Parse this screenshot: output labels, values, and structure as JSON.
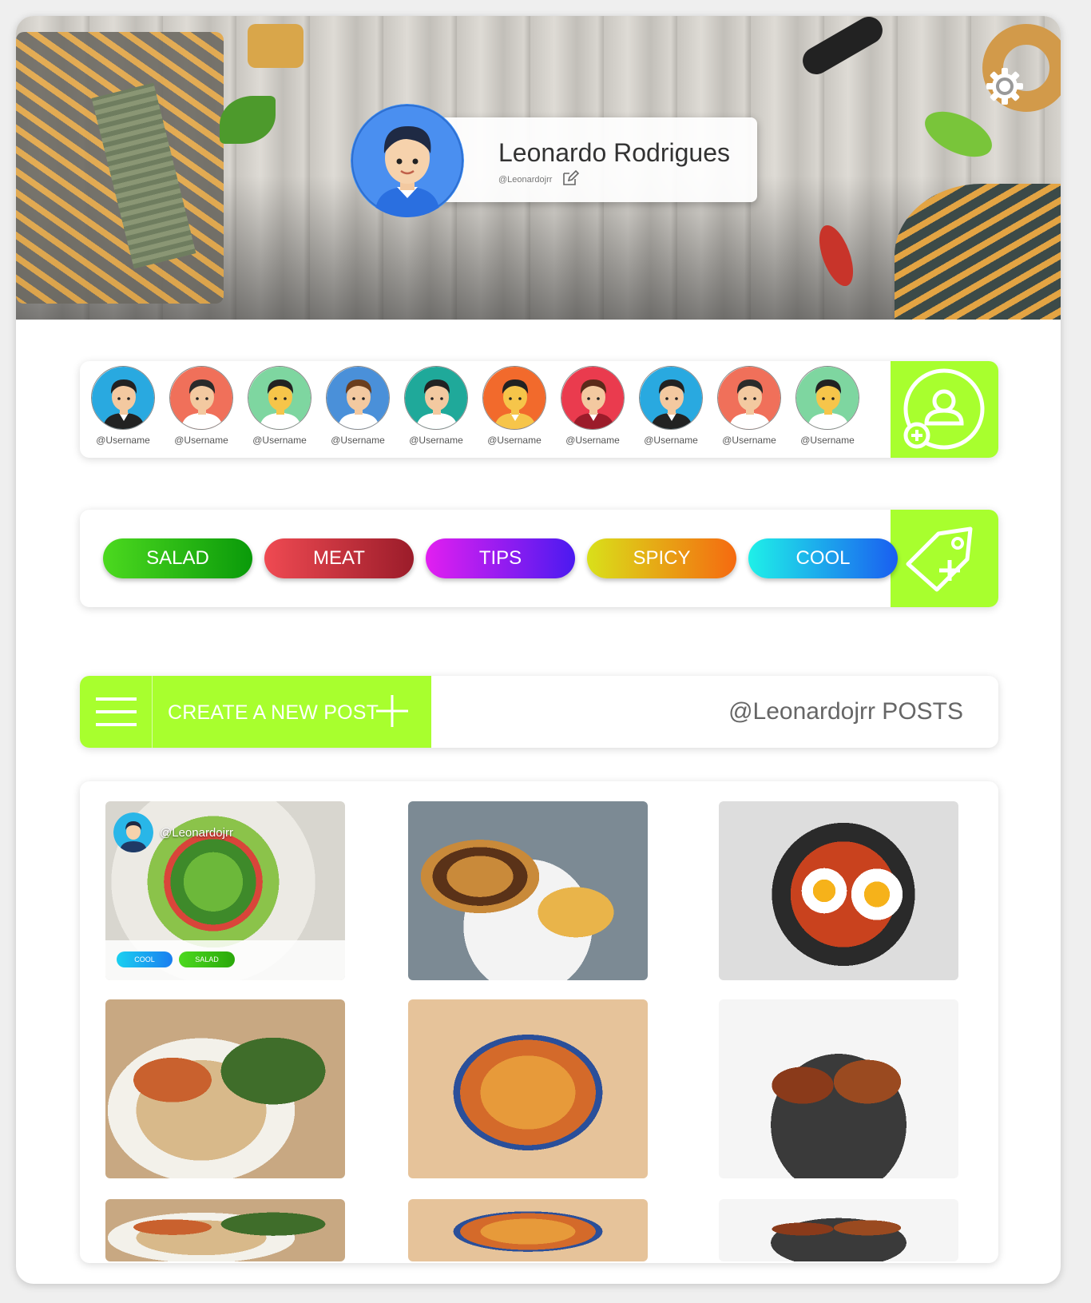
{
  "profile": {
    "name": "Leonardo Rodrigues",
    "handle": "@Leonardojrr"
  },
  "icons": {
    "settings": "gear-icon",
    "edit": "edit-icon",
    "add_friend": "add-user-icon",
    "add_tag": "add-tag-icon",
    "menu": "hamburger-menu-icon",
    "create": "plus-icon"
  },
  "friends": [
    {
      "username": "@Username",
      "bg": "#29a9e0",
      "face": "#f3c9a0",
      "hair": "#222",
      "shirt": "#222"
    },
    {
      "username": "@Username",
      "bg": "#f0705a",
      "face": "#f3c9a0",
      "hair": "#2b2b2b",
      "shirt": "#fff"
    },
    {
      "username": "@Username",
      "bg": "#7ed6a0",
      "face": "#f6c54a",
      "hair": "#222",
      "shirt": "#fff"
    },
    {
      "username": "@Username",
      "bg": "#4a90d9",
      "face": "#f3c9a0",
      "hair": "#6b3e1e",
      "shirt": "#fff"
    },
    {
      "username": "@Username",
      "bg": "#1fa99a",
      "face": "#f3c9a0",
      "hair": "#222",
      "shirt": "#fff"
    },
    {
      "username": "@Username",
      "bg": "#f26a2c",
      "face": "#f6c54a",
      "hair": "#222",
      "shirt": "#f6c54a"
    },
    {
      "username": "@Username",
      "bg": "#ea3b4e",
      "face": "#f3c9a0",
      "hair": "#5a2a1a",
      "shirt": "#9b1c2a"
    },
    {
      "username": "@Username",
      "bg": "#29a9e0",
      "face": "#f3c9a0",
      "hair": "#222",
      "shirt": "#222"
    },
    {
      "username": "@Username",
      "bg": "#f0705a",
      "face": "#f3c9a0",
      "hair": "#2b2b2b",
      "shirt": "#fff"
    },
    {
      "username": "@Username",
      "bg": "#7ed6a0",
      "face": "#f6c54a",
      "hair": "#222",
      "shirt": "#fff"
    }
  ],
  "tags": [
    {
      "label": "SALAD",
      "from": "#4cd91f",
      "to": "#0a9a0a"
    },
    {
      "label": "MEAT",
      "from": "#ef4a52",
      "to": "#9b1c2a"
    },
    {
      "label": "TIPS",
      "from": "#e21ff0",
      "to": "#4b1af0"
    },
    {
      "label": "SPICY",
      "from": "#d9e01a",
      "to": "#f56a10"
    },
    {
      "label": "COOL",
      "from": "#1ff0e8",
      "to": "#1a5ef0"
    }
  ],
  "posts_bar": {
    "create_label": "CREATE A NEW POST",
    "title": "@Leonardojrr POSTS"
  },
  "posts": [
    {
      "kind": "salad",
      "author": "@Leonardojrr",
      "tags": [
        {
          "label": "COOL"
        },
        {
          "label": "SALAD"
        }
      ]
    },
    {
      "kind": "burger"
    },
    {
      "kind": "eggs"
    },
    {
      "kind": "chicken-rice"
    },
    {
      "kind": "lasagna"
    },
    {
      "kind": "wings"
    },
    {
      "kind": "chicken-rice"
    },
    {
      "kind": "lasagna"
    },
    {
      "kind": "wings"
    }
  ],
  "colors": {
    "accent": "#a8ff2e",
    "cool_tag": "#1aa0f0",
    "salad_tag": "#3dd61a"
  }
}
